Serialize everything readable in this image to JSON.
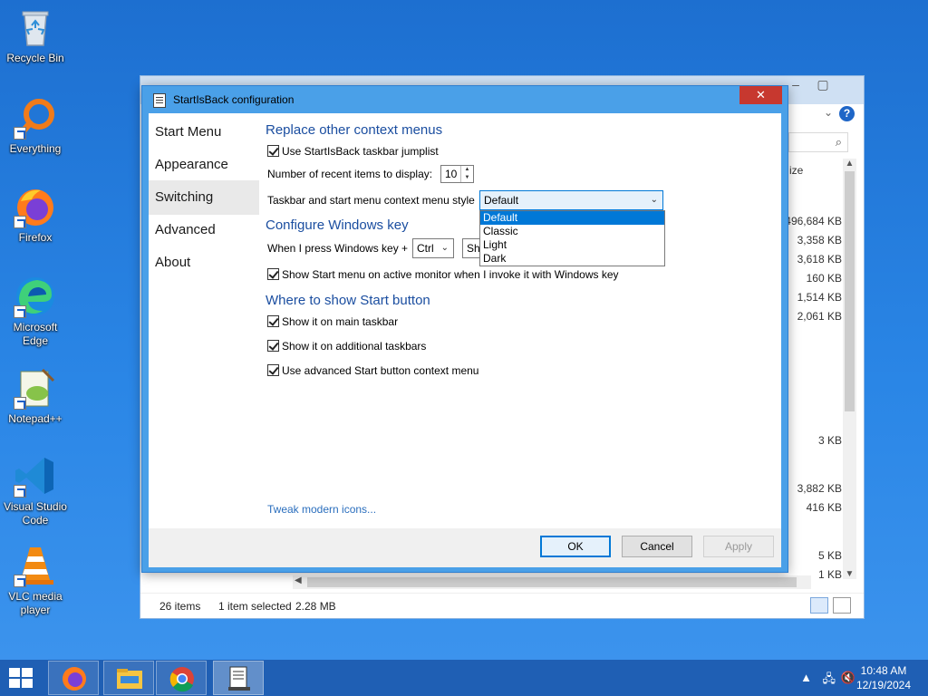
{
  "desktop": {
    "icons": [
      {
        "label": "Recycle Bin"
      },
      {
        "label": "Everything"
      },
      {
        "label": "Firefox"
      },
      {
        "label": "Microsoft Edge"
      },
      {
        "label": "Notepad++"
      },
      {
        "label": "Visual Studio Code"
      },
      {
        "label": "VLC media player"
      }
    ]
  },
  "explorer": {
    "column_header": "ize",
    "sizes": [
      "496,684 KB",
      "3,358 KB",
      "3,618 KB",
      "160 KB",
      "1,514 KB",
      "2,061 KB",
      "3 KB",
      "3,882 KB",
      "416 KB",
      "5 KB",
      "1 KB"
    ],
    "status": {
      "items": "26 items",
      "selected": "1 item selected",
      "size": "2.28 MB"
    }
  },
  "dialog": {
    "title": "StartIsBack configuration",
    "close_label": "✕",
    "nav": [
      "Start Menu",
      "Appearance",
      "Switching",
      "Advanced",
      "About"
    ],
    "selected_nav": "Switching",
    "sections": {
      "context_menus": {
        "heading": "Replace other context menus",
        "jumplist_label": "Use StartIsBack taskbar jumplist",
        "jumplist_checked": true,
        "recent_label": "Number of recent items to display:",
        "recent_value": "10",
        "style_label": "Taskbar and start menu context menu style",
        "style_value": "Default",
        "style_options": [
          "Default",
          "Classic",
          "Light",
          "Dark"
        ]
      },
      "windows_key": {
        "heading": "Configure Windows key",
        "press_label": "When I press Windows key +",
        "modifier_value": "Ctrl",
        "action_value": "Sh",
        "active_monitor_label": "Show Start menu on active monitor when I invoke it with Windows key",
        "active_monitor_checked": true
      },
      "start_button": {
        "heading": "Where to show Start button",
        "main_taskbar_label": "Show it on main taskbar",
        "main_taskbar_checked": true,
        "additional_label": "Show it on additional taskbars",
        "additional_checked": true,
        "advanced_menu_label": "Use advanced Start button context menu",
        "advanced_menu_checked": true
      }
    },
    "tweak_link": "Tweak modern icons...",
    "buttons": {
      "ok": "OK",
      "cancel": "Cancel",
      "apply": "Apply"
    }
  },
  "taskbar": {
    "apps": [
      "firefox-icon",
      "file-explorer-icon",
      "chrome-icon",
      "startisback-config-icon"
    ],
    "clock_time": "10:48 AM",
    "clock_date": "12/19/2024"
  },
  "colors": {
    "accent": "#0078d7",
    "heading": "#1b4ea0",
    "close": "#c7382f",
    "dialog_frame": "#4aa0e8"
  }
}
